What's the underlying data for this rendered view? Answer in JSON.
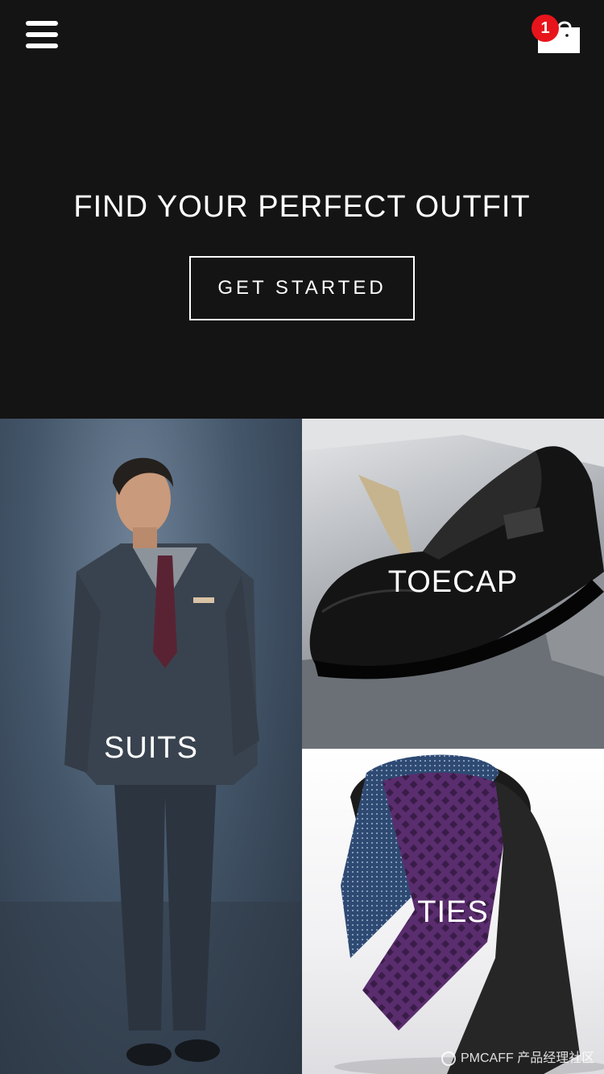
{
  "header": {
    "headline": "FIND YOUR PERFECT OUTFIT",
    "cta_label": "GET STARTED",
    "cart_count": "1",
    "menu_icon": "hamburger-icon",
    "cart_icon": "shopping-bag-icon"
  },
  "categories": [
    {
      "label": "SUITS"
    },
    {
      "label": "TOECAP"
    },
    {
      "label": "TIES"
    }
  ],
  "watermark": "PMCAFF 产品经理社区",
  "colors": {
    "background": "#141414",
    "text": "#ffffff",
    "badge": "#e8141b"
  }
}
